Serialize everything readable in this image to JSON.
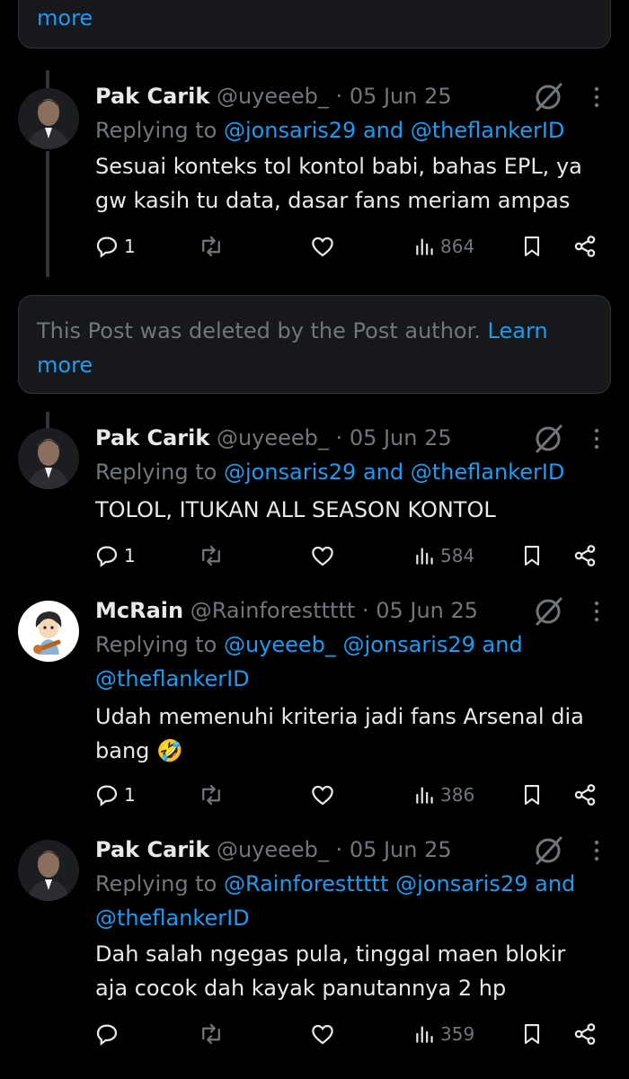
{
  "deleted_top": {
    "more_label": "more"
  },
  "deleted_mid": {
    "text": "This Post was deleted by the Post author.",
    "learn": "Learn",
    "more": "more"
  },
  "tweets": [
    {
      "name": "Pak Carik",
      "handle": "@uyeeeb_",
      "sep": "·",
      "date": "05 Jun 25",
      "replying_prefix": "Replying to",
      "replying_line1": [
        "@jonsaris29",
        "and",
        "@theflankerID"
      ],
      "text_lines": [
        "Sesuai konteks tol kontol babi, bahas EPL, ya",
        "gw kasih tu data, dasar fans meriam ampas"
      ],
      "reply_count": "1",
      "views": "864"
    },
    {
      "name": "Pak Carik",
      "handle": "@uyeeeb_",
      "sep": "·",
      "date": "05 Jun 25",
      "replying_prefix": "Replying to",
      "replying_line1": [
        "@jonsaris29",
        "and",
        "@theflankerID"
      ],
      "text_lines": [
        "TOLOL, ITUKAN ALL SEASON KONTOL"
      ],
      "reply_count": "1",
      "views": "584"
    },
    {
      "name": "McRain",
      "handle": "@Rainforesttttt",
      "sep": "·",
      "date": "05 Jun 25",
      "replying_prefix": "Replying to",
      "replying_line1": [
        "@uyeeeb_",
        "@jonsaris29",
        "and"
      ],
      "replying_line2": "@theflankerID",
      "text_lines": [
        "Udah memenuhi kriteria jadi fans Arsenal dia",
        "bang"
      ],
      "emoji": "🤣",
      "reply_count": "1",
      "views": "386"
    },
    {
      "name": "Pak Carik",
      "handle": "@uyeeeb_",
      "sep": "·",
      "date": "05 Jun 25",
      "replying_prefix": "Replying to",
      "replying_line1": [
        "@Rainforesttttt",
        "@jonsaris29",
        "and"
      ],
      "replying_line2": "@theflankerID",
      "text_lines": [
        "Dah salah ngegas pula, tinggal maen blokir",
        "aja cocok dah kayak panutannya 2 hp"
      ],
      "reply_count": "",
      "views": "359"
    }
  ],
  "icons": {
    "reply": "reply-icon",
    "repost": "repost-icon",
    "like": "like-icon",
    "views": "views-icon",
    "bookmark": "bookmark-icon",
    "share": "share-icon",
    "grok": "grok-icon",
    "more": "more-icon"
  },
  "colors": {
    "background": "#000000",
    "text": "#e7e9ea",
    "muted": "#71767b",
    "link": "#1d9bf0",
    "card": "#16181c"
  }
}
